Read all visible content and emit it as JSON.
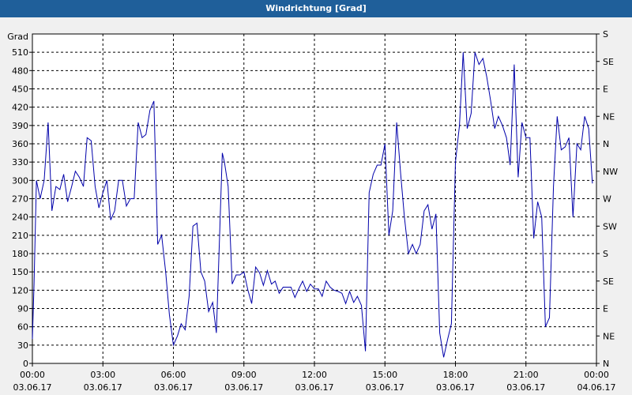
{
  "window": {
    "title": "Windrichtung [Grad]"
  },
  "chart_data": {
    "type": "line",
    "title": "Windrichtung [Grad]",
    "ylabel": "Grad",
    "ylim": [
      0,
      540
    ],
    "xlim_hours": [
      0,
      24
    ],
    "grid": true,
    "y_ticks": [
      0,
      30,
      60,
      90,
      120,
      150,
      180,
      210,
      240,
      270,
      300,
      330,
      360,
      390,
      420,
      450,
      480,
      510
    ],
    "right_ticks": [
      {
        "v": 0,
        "label": "N"
      },
      {
        "v": 45,
        "label": "NE"
      },
      {
        "v": 90,
        "label": "E"
      },
      {
        "v": 135,
        "label": "SE"
      },
      {
        "v": 180,
        "label": "S"
      },
      {
        "v": 225,
        "label": "SW"
      },
      {
        "v": 270,
        "label": "W"
      },
      {
        "v": 315,
        "label": "NW"
      },
      {
        "v": 360,
        "label": "N"
      },
      {
        "v": 405,
        "label": "NE"
      },
      {
        "v": 450,
        "label": "E"
      },
      {
        "v": 495,
        "label": "SE"
      },
      {
        "v": 540,
        "label": "S"
      }
    ],
    "x_ticks": [
      {
        "h": 0,
        "time": "00:00",
        "date": "03.06.17"
      },
      {
        "h": 3,
        "time": "03:00",
        "date": "03.06.17"
      },
      {
        "h": 6,
        "time": "06:00",
        "date": "03.06.17"
      },
      {
        "h": 9,
        "time": "09:00",
        "date": "03.06.17"
      },
      {
        "h": 12,
        "time": "12:00",
        "date": "03.06.17"
      },
      {
        "h": 15,
        "time": "15:00",
        "date": "03.06.17"
      },
      {
        "h": 18,
        "time": "18:00",
        "date": "03.06.17"
      },
      {
        "h": 21,
        "time": "21:00",
        "date": "03.06.17"
      },
      {
        "h": 24,
        "time": "00:00",
        "date": "04.06.17"
      }
    ],
    "series": [
      {
        "color": "#0000aa",
        "points": [
          [
            0.0,
            40
          ],
          [
            0.07,
            130
          ],
          [
            0.17,
            300
          ],
          [
            0.33,
            270
          ],
          [
            0.5,
            300
          ],
          [
            0.67,
            395
          ],
          [
            0.83,
            250
          ],
          [
            1.0,
            290
          ],
          [
            1.17,
            285
          ],
          [
            1.33,
            310
          ],
          [
            1.5,
            265
          ],
          [
            1.67,
            290
          ],
          [
            1.83,
            315
          ],
          [
            2.0,
            305
          ],
          [
            2.17,
            290
          ],
          [
            2.33,
            370
          ],
          [
            2.5,
            365
          ],
          [
            2.67,
            290
          ],
          [
            2.83,
            255
          ],
          [
            3.0,
            280
          ],
          [
            3.17,
            300
          ],
          [
            3.33,
            235
          ],
          [
            3.5,
            250
          ],
          [
            3.67,
            300
          ],
          [
            3.83,
            300
          ],
          [
            4.0,
            258
          ],
          [
            4.17,
            270
          ],
          [
            4.33,
            270
          ],
          [
            4.5,
            395
          ],
          [
            4.67,
            370
          ],
          [
            4.83,
            375
          ],
          [
            5.0,
            415
          ],
          [
            5.17,
            430
          ],
          [
            5.33,
            195
          ],
          [
            5.5,
            210
          ],
          [
            5.67,
            150
          ],
          [
            5.83,
            80
          ],
          [
            6.0,
            30
          ],
          [
            6.17,
            45
          ],
          [
            6.33,
            65
          ],
          [
            6.5,
            55
          ],
          [
            6.67,
            110
          ],
          [
            6.83,
            225
          ],
          [
            7.0,
            230
          ],
          [
            7.17,
            150
          ],
          [
            7.33,
            135
          ],
          [
            7.5,
            85
          ],
          [
            7.67,
            100
          ],
          [
            7.83,
            50
          ],
          [
            8.0,
            250
          ],
          [
            8.08,
            345
          ],
          [
            8.17,
            330
          ],
          [
            8.33,
            290
          ],
          [
            8.5,
            130
          ],
          [
            8.67,
            145
          ],
          [
            8.83,
            145
          ],
          [
            9.0,
            150
          ],
          [
            9.17,
            120
          ],
          [
            9.33,
            98
          ],
          [
            9.5,
            158
          ],
          [
            9.67,
            148
          ],
          [
            9.83,
            128
          ],
          [
            10.0,
            152
          ],
          [
            10.17,
            130
          ],
          [
            10.33,
            135
          ],
          [
            10.5,
            115
          ],
          [
            10.67,
            125
          ],
          [
            10.83,
            125
          ],
          [
            11.0,
            125
          ],
          [
            11.17,
            108
          ],
          [
            11.33,
            122
          ],
          [
            11.5,
            135
          ],
          [
            11.67,
            118
          ],
          [
            11.83,
            130
          ],
          [
            12.0,
            122
          ],
          [
            12.17,
            122
          ],
          [
            12.33,
            110
          ],
          [
            12.5,
            135
          ],
          [
            12.67,
            125
          ],
          [
            12.83,
            120
          ],
          [
            13.0,
            118
          ],
          [
            13.17,
            115
          ],
          [
            13.33,
            98
          ],
          [
            13.5,
            118
          ],
          [
            13.67,
            100
          ],
          [
            13.83,
            110
          ],
          [
            14.0,
            95
          ],
          [
            14.17,
            20
          ],
          [
            14.33,
            280
          ],
          [
            14.5,
            310
          ],
          [
            14.67,
            325
          ],
          [
            14.83,
            325
          ],
          [
            15.0,
            360
          ],
          [
            15.17,
            210
          ],
          [
            15.33,
            250
          ],
          [
            15.5,
            395
          ],
          [
            15.67,
            310
          ],
          [
            15.83,
            240
          ],
          [
            16.0,
            180
          ],
          [
            16.17,
            195
          ],
          [
            16.33,
            180
          ],
          [
            16.5,
            195
          ],
          [
            16.67,
            250
          ],
          [
            16.83,
            260
          ],
          [
            17.0,
            220
          ],
          [
            17.17,
            245
          ],
          [
            17.33,
            50
          ],
          [
            17.5,
            10
          ],
          [
            17.67,
            40
          ],
          [
            17.83,
            65
          ],
          [
            18.0,
            330
          ],
          [
            18.17,
            390
          ],
          [
            18.33,
            510
          ],
          [
            18.5,
            385
          ],
          [
            18.67,
            410
          ],
          [
            18.83,
            510
          ],
          [
            19.0,
            490
          ],
          [
            19.17,
            500
          ],
          [
            19.33,
            470
          ],
          [
            19.5,
            430
          ],
          [
            19.67,
            385
          ],
          [
            19.83,
            405
          ],
          [
            20.0,
            390
          ],
          [
            20.17,
            370
          ],
          [
            20.33,
            325
          ],
          [
            20.5,
            490
          ],
          [
            20.67,
            305
          ],
          [
            20.83,
            395
          ],
          [
            21.0,
            370
          ],
          [
            21.17,
            370
          ],
          [
            21.33,
            205
          ],
          [
            21.5,
            265
          ],
          [
            21.67,
            240
          ],
          [
            21.83,
            60
          ],
          [
            22.0,
            75
          ],
          [
            22.17,
            290
          ],
          [
            22.33,
            405
          ],
          [
            22.5,
            350
          ],
          [
            22.67,
            355
          ],
          [
            22.83,
            370
          ],
          [
            23.0,
            240
          ],
          [
            23.17,
            360
          ],
          [
            23.33,
            350
          ],
          [
            23.5,
            405
          ],
          [
            23.67,
            385
          ],
          [
            23.83,
            295
          ]
        ]
      }
    ]
  }
}
